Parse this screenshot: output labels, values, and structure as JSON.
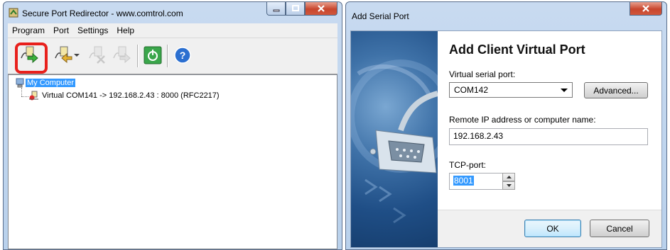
{
  "main_window": {
    "title": "Secure Port Redirector - www.comtrol.com",
    "menu": [
      {
        "label": "Program"
      },
      {
        "label": "Port"
      },
      {
        "label": "Settings"
      },
      {
        "label": "Help"
      }
    ],
    "toolbar": {
      "add_client_port": "add-client-port-icon",
      "add_server_port": "add-server-port-icon",
      "remove_port": "remove-port-icon",
      "port_properties": "port-properties-icon",
      "power": "power-icon",
      "help": "help-icon",
      "highlight_color": "#e8201c"
    },
    "tree": {
      "root": "My Computer",
      "children": [
        "Virtual COM141 -> 192.168.2.43 : 8000 (RFC2217)"
      ]
    }
  },
  "dialog": {
    "title": "Add Serial Port",
    "heading": "Add Client Virtual Port",
    "virtual_port_label": "Virtual serial port:",
    "virtual_port_value": "COM142",
    "advanced_button": "Advanced...",
    "remote_label": "Remote IP address or computer name:",
    "remote_value": "192.168.2.43",
    "tcp_label": "TCP-port:",
    "tcp_value": "8001",
    "ok_button": "OK",
    "cancel_button": "Cancel"
  }
}
